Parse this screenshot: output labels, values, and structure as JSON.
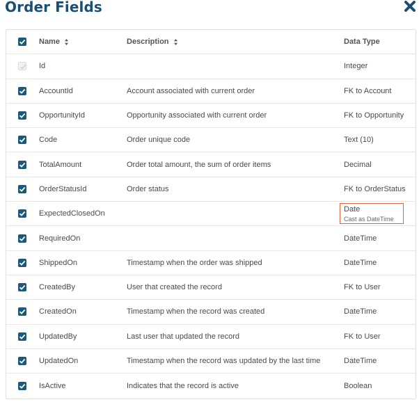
{
  "title": "Order Fields",
  "close_icon": "close-icon",
  "columns": {
    "name": "Name",
    "description": "Description",
    "data_type": "Data Type"
  },
  "rows": [
    {
      "name": "Id",
      "description": "",
      "type": "Integer",
      "checked": true,
      "disabled": true
    },
    {
      "name": "AccountId",
      "description": "Account associated with current order",
      "type": "FK to Account",
      "checked": true
    },
    {
      "name": "OpportunityId",
      "description": "Opportunity associated with current order",
      "type": "FK to Opportunity",
      "checked": true
    },
    {
      "name": "Code",
      "description": "Order unique code",
      "type": "Text (10)",
      "checked": true
    },
    {
      "name": "TotalAmount",
      "description": "Order total amount, the sum of order items",
      "type": "Decimal",
      "checked": true
    },
    {
      "name": "OrderStatusId",
      "description": "Order status",
      "type": "FK to OrderStatus",
      "checked": true
    },
    {
      "name": "ExpectedClosedOn",
      "description": "",
      "type": "Date",
      "type_note": "Cast as DateTime",
      "checked": true,
      "highlighted": true
    },
    {
      "name": "RequiredOn",
      "description": "",
      "type": "DateTime",
      "checked": true
    },
    {
      "name": "ShippedOn",
      "description": "Timestamp when the order was shipped",
      "type": "DateTime",
      "checked": true
    },
    {
      "name": "CreatedBy",
      "description": "User that created the record",
      "type": "FK to User",
      "checked": true
    },
    {
      "name": "CreatedOn",
      "description": "Timestamp when the record was created",
      "type": "DateTime",
      "checked": true
    },
    {
      "name": "UpdatedBy",
      "description": "Last user that updated the record",
      "type": "FK to User",
      "checked": true
    },
    {
      "name": "UpdatedOn",
      "description": "Timestamp when the record was updated by the last time",
      "type": "DateTime",
      "checked": true
    },
    {
      "name": "IsActive",
      "description": "Indicates that the record is active",
      "type": "Boolean",
      "checked": true
    }
  ],
  "colors": {
    "title": "#1b4f72",
    "checkbox": "#1e5878",
    "highlight_border": "#e0653a"
  }
}
